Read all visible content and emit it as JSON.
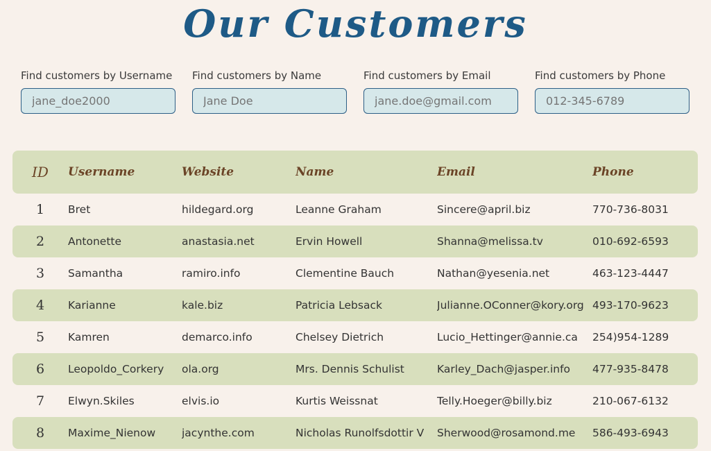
{
  "page": {
    "title": "Our Customers"
  },
  "filters": [
    {
      "label": "Find customers by Username",
      "placeholder": "jane_doe2000"
    },
    {
      "label": "Find customers by Name",
      "placeholder": "Jane Doe"
    },
    {
      "label": "Find customers by Email",
      "placeholder": "jane.doe@gmail.com"
    },
    {
      "label": "Find customers by Phone",
      "placeholder": "012-345-6789"
    }
  ],
  "table": {
    "headers": {
      "id": "ID",
      "username": "Username",
      "website": "Website",
      "name": "Name",
      "email": "Email",
      "phone": "Phone"
    },
    "rows": [
      {
        "id": "1",
        "username": "Bret",
        "website": "hildegard.org",
        "name": "Leanne Graham",
        "email": "Sincere@april.biz",
        "phone": "770-736-8031"
      },
      {
        "id": "2",
        "username": "Antonette",
        "website": "anastasia.net",
        "name": "Ervin Howell",
        "email": "Shanna@melissa.tv",
        "phone": "010-692-6593"
      },
      {
        "id": "3",
        "username": "Samantha",
        "website": "ramiro.info",
        "name": "Clementine Bauch",
        "email": "Nathan@yesenia.net",
        "phone": "463-123-4447"
      },
      {
        "id": "4",
        "username": "Karianne",
        "website": "kale.biz",
        "name": "Patricia Lebsack",
        "email": "Julianne.OConner@kory.org",
        "phone": "493-170-9623"
      },
      {
        "id": "5",
        "username": "Kamren",
        "website": "demarco.info",
        "name": "Chelsey Dietrich",
        "email": "Lucio_Hettinger@annie.ca",
        "phone": "254)954-1289"
      },
      {
        "id": "6",
        "username": "Leopoldo_Corkery",
        "website": "ola.org",
        "name": "Mrs. Dennis Schulist",
        "email": "Karley_Dach@jasper.info",
        "phone": "477-935-8478"
      },
      {
        "id": "7",
        "username": "Elwyn.Skiles",
        "website": "elvis.io",
        "name": "Kurtis Weissnat",
        "email": "Telly.Hoeger@billy.biz",
        "phone": "210-067-6132"
      },
      {
        "id": "8",
        "username": "Maxime_Nienow",
        "website": "jacynthe.com",
        "name": "Nicholas Runolfsdottir V",
        "email": "Sherwood@rosamond.me",
        "phone": "586-493-6943"
      }
    ]
  }
}
